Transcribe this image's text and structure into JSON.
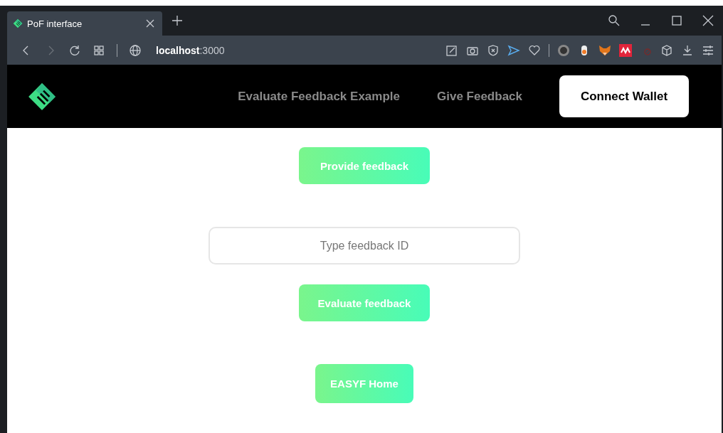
{
  "browser": {
    "tab": {
      "title": "PoF interface",
      "selected": true
    },
    "address": "**localhost**:3000"
  },
  "nav": {
    "links": [
      "Evaluate Feedback Example",
      "Give Feedback"
    ],
    "connect_button": "Connect Wallet"
  },
  "content": {
    "provide_button": "Provide feedback",
    "feedback_id": {
      "placeholder": "Type feedback ID"
    },
    "evaluate_button": "Evaluate feedback",
    "home_button": "EASYF Home"
  }
}
